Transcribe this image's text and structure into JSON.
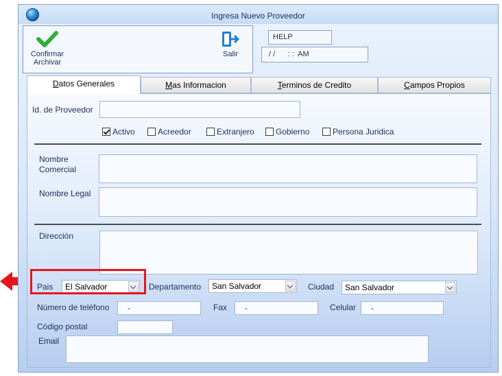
{
  "window": {
    "title": "Ingresa Nuevo Proveedor"
  },
  "toolbar": {
    "confirm_label": "Confirmar Archivar",
    "exit_label": "Salir"
  },
  "help_box": {
    "value": "HELP"
  },
  "datetime_box": {
    "value": "/ /      : :  AM"
  },
  "tabs": [
    {
      "label": "Datos Generales",
      "mnemonic": "D",
      "rest": "atos Generales",
      "active": true
    },
    {
      "label": "Mas Informacion",
      "mnemonic": "M",
      "rest": "as Informacion",
      "active": false
    },
    {
      "label": "Terminos de Credito",
      "mnemonic": "T",
      "rest": "erminos de Credito",
      "active": false
    },
    {
      "label": "Campos Propios",
      "mnemonic": "C",
      "rest": "ampos Propios",
      "active": false
    }
  ],
  "form": {
    "supplier_id": {
      "label": "Id. de Proveedor",
      "value": ""
    },
    "checkboxes": [
      {
        "label": "Activo",
        "checked": true
      },
      {
        "label": "Acreedor",
        "checked": false
      },
      {
        "label": "Extranjero",
        "checked": false
      },
      {
        "label": "Gobierno",
        "checked": false
      },
      {
        "label": "Persona Juridica",
        "checked": false
      }
    ],
    "commercial_name": {
      "label_line1": "Nombre",
      "label_line2": "Comercial",
      "value": ""
    },
    "legal_name": {
      "label": "Nombre Legal",
      "value": ""
    },
    "address": {
      "label": "Dirección",
      "value": ""
    },
    "country": {
      "label": "Pais",
      "value": "El Salvador"
    },
    "department": {
      "label": "Departamento",
      "value": "San Salvador"
    },
    "city": {
      "label": "Ciudad",
      "value": "San Salvador"
    },
    "phone": {
      "label": "Número de teléfono",
      "value": "-"
    },
    "fax": {
      "label": "Fax",
      "value": "-"
    },
    "cell": {
      "label": "Celular",
      "value": "-"
    },
    "postal_code": {
      "label": "Código postal",
      "value": ""
    },
    "email": {
      "label": "Email",
      "value": ""
    }
  },
  "colors": {
    "highlight": "#e5151d",
    "check_green": "#2fae3a",
    "exit_blue": "#1f7fd6"
  },
  "icons": {
    "confirm": "checkmark-icon",
    "exit": "exit-door-icon",
    "app": "globe-logo-icon"
  }
}
